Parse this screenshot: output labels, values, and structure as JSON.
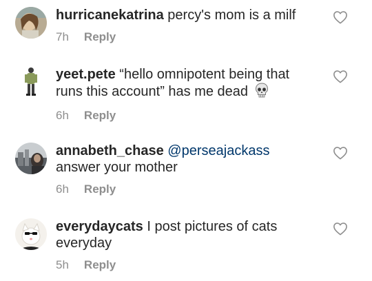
{
  "comments": [
    {
      "username": "hurricanekatrina",
      "text": "percy's mom is a milf",
      "time": "7h",
      "reply_label": "Reply",
      "avatar_icon": "profile-photo-icon",
      "like_icon": "heart-outline-icon"
    },
    {
      "username": "yeet.pete",
      "text": "“hello omnipotent being that runs this account” has me dead",
      "emoji": "skull-emoji",
      "time": "6h",
      "reply_label": "Reply",
      "avatar_icon": "profile-photo-icon",
      "like_icon": "heart-outline-icon"
    },
    {
      "username": "annabeth_chase",
      "mention": "@perseajackass",
      "text": "answer your mother",
      "time": "6h",
      "reply_label": "Reply",
      "avatar_icon": "profile-photo-icon",
      "like_icon": "heart-outline-icon"
    },
    {
      "username": "everydaycats",
      "text": "I post pictures of cats everyday",
      "time": "5h",
      "reply_label": "Reply",
      "avatar_icon": "profile-photo-icon",
      "like_icon": "heart-outline-icon"
    }
  ],
  "colors": {
    "text": "#262626",
    "meta": "#8e8e8e",
    "mention": "#00376b"
  }
}
